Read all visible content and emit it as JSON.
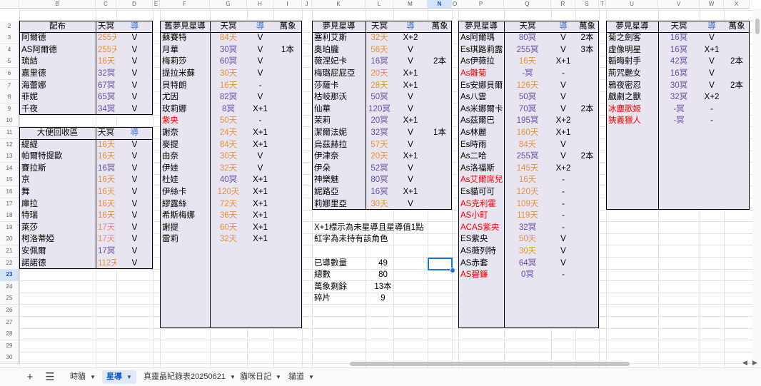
{
  "columns": [
    "",
    "B",
    "C",
    "D",
    "E",
    "F",
    "G",
    "H",
    "I",
    "J",
    "K",
    "L",
    "M",
    "N",
    "O",
    "P",
    "Q",
    "R",
    "S",
    "T",
    "U",
    "V",
    "W",
    "X"
  ],
  "selected_column": "N",
  "selected_row": "23",
  "rows": [
    "2",
    "3",
    "4",
    "5",
    "6",
    "7",
    "8",
    "9",
    "10",
    "11",
    "12",
    "13",
    "14",
    "15",
    "16",
    "17",
    "18",
    "19",
    "20",
    "21",
    "22",
    "23",
    "24",
    "25",
    "26",
    "27",
    "28",
    "29",
    "30"
  ],
  "table_haipei": {
    "headers": [
      "配布",
      "天冥",
      "導"
    ],
    "rows": [
      [
        "阿爾德",
        "255天",
        "V"
      ],
      [
        "AS阿爾德",
        "255天",
        "V"
      ],
      [
        "琉結",
        "16天",
        "V"
      ],
      [
        "嘉里德",
        "32冥",
        "V"
      ],
      [
        "海蕾娜",
        "67冥",
        "V"
      ],
      [
        "菲妮",
        "65冥",
        "V"
      ],
      [
        "千夜",
        "34冥",
        "V"
      ]
    ],
    "colors": [
      "orange",
      "orange",
      "orange",
      "purple",
      "purple",
      "purple",
      "purple"
    ]
  },
  "table_recycle": {
    "headers": [
      "大便回收區",
      "天冥",
      "導"
    ],
    "rows": [
      [
        "緹緹",
        "16天",
        "V"
      ],
      [
        "帕爾特提歐",
        "16天",
        "V"
      ],
      [
        "賽拉斯",
        "16冥",
        "V"
      ],
      [
        "京",
        "16天",
        "V"
      ],
      [
        "舞",
        "16天",
        "V"
      ],
      [
        "庫拉",
        "16天",
        "V"
      ],
      [
        "特瑞",
        "16天",
        "V"
      ],
      [
        "萊莎",
        "17天",
        "V"
      ],
      [
        "柯洛蒂婭",
        "17天",
        "V"
      ],
      [
        "安佩爾",
        "17冥",
        "V"
      ],
      [
        "諾諾德",
        "112天",
        "V"
      ]
    ],
    "colors": [
      "orange",
      "orange",
      "purple",
      "orange",
      "orange",
      "orange",
      "orange",
      "orange",
      "orange",
      "purple",
      "orange"
    ]
  },
  "table_old": {
    "headers": [
      "舊夢見星導",
      "天冥",
      "導",
      "萬象"
    ],
    "rows": [
      [
        "蘇賽特",
        "84天",
        "V",
        ""
      ],
      [
        "月華",
        "30冥",
        "V",
        "1本"
      ],
      [
        "梅莉莎",
        "60冥",
        "V",
        ""
      ],
      [
        "提拉米蘇",
        "30天",
        "V",
        ""
      ],
      [
        "貝特朗",
        "16天",
        "-",
        ""
      ],
      [
        "尤因",
        "82冥",
        "V",
        ""
      ],
      [
        "玫莉娜",
        "8冥",
        "X+1",
        ""
      ],
      [
        "紫央",
        "50天",
        "-",
        ""
      ],
      [
        "謝奈",
        "24天",
        "X+1",
        ""
      ],
      [
        "麥提",
        "84天",
        "X+1",
        ""
      ],
      [
        "由奈",
        "30天",
        "V",
        ""
      ],
      [
        "伊娃",
        "32天",
        "V",
        ""
      ],
      [
        "杜娃",
        "40冥",
        "X+1",
        ""
      ],
      [
        "伊絲卡",
        "120天",
        "X+1",
        ""
      ],
      [
        "繆露絲",
        "72天",
        "X+1",
        ""
      ],
      [
        "希斯梅娜",
        "36天",
        "X+1",
        ""
      ],
      [
        "謝提",
        "60天",
        "X+1",
        ""
      ],
      [
        "雷莉",
        "32天",
        "X+1",
        ""
      ]
    ],
    "colors": [
      "orange",
      "purple",
      "purple",
      "orange",
      "orange",
      "purple",
      "purple",
      "orange",
      "orange",
      "orange",
      "orange",
      "orange",
      "purple",
      "orange",
      "orange",
      "orange",
      "orange",
      "orange"
    ],
    "red_names": [
      7
    ]
  },
  "table_dream1": {
    "headers": [
      "夢見星導",
      "天冥",
      "導",
      "萬象"
    ],
    "rows": [
      [
        "塞利艾斯",
        "32天",
        "X+2",
        ""
      ],
      [
        "奧珀朧",
        "56天",
        "V",
        ""
      ],
      [
        "薇涅妃卡",
        "16冥",
        "V",
        "2本"
      ],
      [
        "梅璐屁屁亞",
        "20天",
        "X+1",
        ""
      ],
      [
        "莎薩卡",
        "28天",
        "X+1",
        ""
      ],
      [
        "枯岐那沃",
        "50冥",
        "V",
        ""
      ],
      [
        "仙華",
        "120冥",
        "V",
        ""
      ],
      [
        "茉莉",
        "20冥",
        "X+1",
        ""
      ],
      [
        "潔爾法妮",
        "32冥",
        "V",
        "1本"
      ],
      [
        "烏茲赫拉",
        "57天",
        "V",
        ""
      ],
      [
        "伊津奈",
        "20天",
        "X+1",
        ""
      ],
      [
        "伊朵",
        "52冥",
        "V",
        ""
      ],
      [
        "神樂魅",
        "80冥",
        "V",
        ""
      ],
      [
        "妮路亞",
        "16冥",
        "X+1",
        ""
      ],
      [
        "莉娜里亞",
        "30天",
        "V",
        ""
      ]
    ],
    "colors": [
      "orange",
      "orange",
      "purple",
      "orange",
      "orange",
      "purple",
      "purple",
      "purple",
      "purple",
      "orange",
      "orange",
      "purple",
      "purple",
      "purple",
      "orange"
    ]
  },
  "notes": {
    "line1": "X+1標示為未星導且星導值1點",
    "line2": "紅字為未持有該角色"
  },
  "stats": [
    [
      "已導數量",
      "49"
    ],
    [
      "總數",
      "80"
    ],
    [
      "萬象剩餘",
      "13本"
    ],
    [
      "碎片",
      "9"
    ]
  ],
  "table_dream2": {
    "headers": [
      "夢見星導",
      "天冥",
      "導",
      "萬象"
    ],
    "rows": [
      [
        "As阿爾瑪",
        "80冥",
        "V",
        "2本"
      ],
      [
        "Es琪路莉露",
        "255冥",
        "V",
        "3本"
      ],
      [
        "As伊薇拉",
        "16天",
        "X+1",
        ""
      ],
      [
        "As雛菊",
        "-冥",
        "-",
        ""
      ],
      [
        "Es安娜貝爾",
        "126天",
        "V",
        ""
      ],
      [
        "As八雲",
        "50冥",
        "V",
        ""
      ],
      [
        "As米娜爾卡",
        "70冥",
        "V",
        "2本"
      ],
      [
        "As茲爾巴",
        "195冥",
        "X+2",
        ""
      ],
      [
        "As林麗",
        "160天",
        "X+1",
        ""
      ],
      [
        "Es時雨",
        "84天",
        "V",
        ""
      ],
      [
        "As二哈",
        "255冥",
        "V",
        "2本"
      ],
      [
        "As洛福斯",
        "145天",
        "X+2",
        ""
      ],
      [
        "As艾爾席兒",
        "16天",
        "-",
        ""
      ],
      [
        "Es貓可可",
        "120天",
        "-",
        ""
      ],
      [
        "AS克利霍",
        "109天",
        "-",
        ""
      ],
      [
        "AS小町",
        "119天",
        "-",
        ""
      ],
      [
        "ACAS紫央",
        "32冥",
        "-",
        ""
      ],
      [
        "ES紫央",
        "50天",
        "V",
        ""
      ],
      [
        "AS薇列特",
        "30天",
        "V",
        ""
      ],
      [
        "AS赤套",
        "64冥",
        "V",
        ""
      ],
      [
        "AS碧鐮",
        "0冥",
        "-",
        ""
      ]
    ],
    "colors": [
      "purple",
      "purple",
      "orange",
      "purple",
      "orange",
      "purple",
      "purple",
      "purple",
      "orange",
      "orange",
      "purple",
      "orange",
      "orange",
      "orange",
      "orange",
      "orange",
      "purple",
      "orange",
      "orange",
      "purple",
      "purple"
    ],
    "red_names": [
      3,
      12,
      14,
      15,
      16,
      20
    ]
  },
  "table_dream3": {
    "headers": [
      "夢見星導",
      "天冥",
      "導",
      "萬象"
    ],
    "rows": [
      [
        "菊之劍客",
        "16冥",
        "V",
        ""
      ],
      [
        "虛像明星",
        "16冥",
        "X+1",
        ""
      ],
      [
        "韜晦射手",
        "42冥",
        "V",
        "2本"
      ],
      [
        "荊咒艷女",
        "16冥",
        "V",
        ""
      ],
      [
        "鴉夜密忍",
        "30冥",
        "V",
        "2本"
      ],
      [
        "戲劇之獸",
        "32冥",
        "X+2",
        ""
      ],
      [
        "冰塵歌姬",
        "-冥",
        "-",
        ""
      ],
      [
        "狹義獵人",
        "-冥",
        "-",
        ""
      ]
    ],
    "colors": [
      "purple",
      "purple",
      "purple",
      "purple",
      "purple",
      "purple",
      "purple",
      "purple"
    ],
    "red_names": [
      6,
      7
    ]
  },
  "tabs": [
    "時貓",
    "星導",
    "真靈晶紀錄表20250621",
    "貓咪日記",
    "貓道"
  ],
  "active_tab": 1,
  "tab_arrow": "▼",
  "add_sheet": "+",
  "all_sheets": "☰",
  "colors_hex": {
    "orange": "#e69138",
    "purple": "#674ea7",
    "red": "#ff0000",
    "table_bg": "#e8e4f0"
  }
}
